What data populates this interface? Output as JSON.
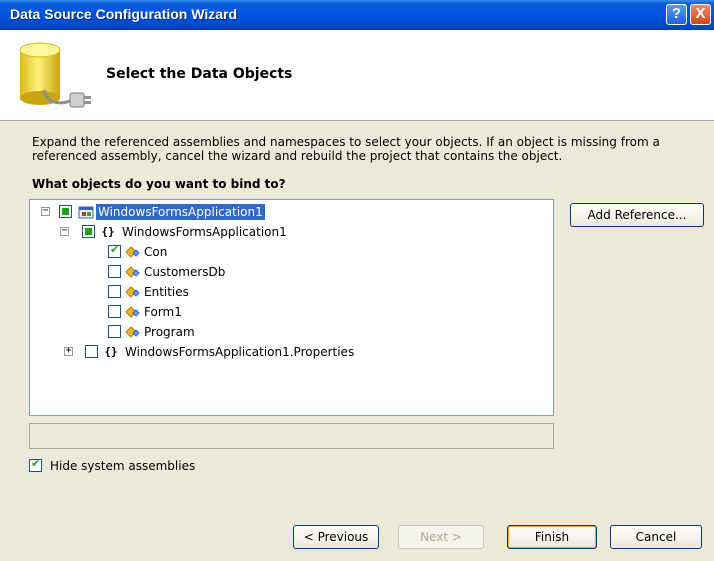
{
  "window": {
    "title": "Data Source Configuration Wizard",
    "help_glyph": "?",
    "close_glyph": "X"
  },
  "header": {
    "title": "Select the Data Objects",
    "icon": "database-plug-icon"
  },
  "description": "Expand the referenced assemblies and namespaces to select your objects. If an object is missing from a\nreferenced assembly, cancel the wizard and rebuild the project that contains the object.",
  "question": "What objects do you want to bind to?",
  "tree": {
    "root": {
      "label": "WindowsFormsApplication1",
      "expanded": true,
      "state": "partial",
      "selected": true,
      "icon": "project-icon"
    },
    "namespace": {
      "label": "WindowsFormsApplication1",
      "expanded": true,
      "state": "partial",
      "icon": "namespace-braces-icon"
    },
    "classes": [
      {
        "label": "Con",
        "checked": true,
        "icon": "class-icon"
      },
      {
        "label": "CustomersDb",
        "checked": false,
        "icon": "class-icon"
      },
      {
        "label": "Entities",
        "checked": false,
        "icon": "class-icon"
      },
      {
        "label": "Form1",
        "checked": false,
        "icon": "class-icon"
      },
      {
        "label": "Program",
        "checked": false,
        "icon": "class-icon"
      }
    ],
    "properties_namespace": {
      "label": "WindowsFormsApplication1.Properties",
      "expanded": false,
      "state": "unchecked",
      "icon": "namespace-braces-icon"
    },
    "ns_glyph": "{}",
    "expand_glyph": "+",
    "collapse_glyph": "−"
  },
  "hide_system_assemblies": {
    "label": "Hide system assemblies",
    "checked": true
  },
  "buttons": {
    "add_reference": "Add Reference...",
    "previous": "< Previous",
    "next": "Next >",
    "finish": "Finish",
    "cancel": "Cancel"
  },
  "colors": {
    "titlebar": "#0055e5",
    "selection": "#316ac5",
    "check_green": "#21a121",
    "dialog_bg": "#ece9d8"
  }
}
